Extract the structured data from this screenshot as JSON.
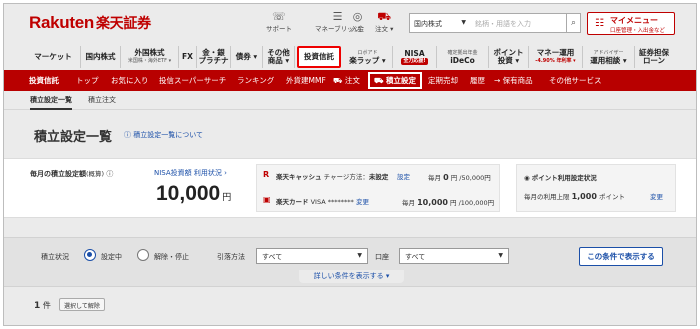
{
  "header": {
    "logo": "Rakuten",
    "logo_sub": "楽天証券",
    "icons": [
      {
        "name": "support",
        "label": "サポート",
        "glyph": "☏"
      },
      {
        "name": "money-bridge",
        "label": "マネーブリッジ",
        "glyph": "☰"
      },
      {
        "name": "deposit",
        "label": "入金",
        "glyph": "◎"
      },
      {
        "name": "order",
        "label": "注文 ▾",
        "glyph": "⛟"
      }
    ],
    "market_select": "国内株式",
    "search_placeholder": "銘柄・用語を入力",
    "mymenu_title": "マイメニュー",
    "mymenu_sub": "口座管理・入出金など"
  },
  "mainnav": [
    {
      "label": "マーケット"
    },
    {
      "label": "国内株式"
    },
    {
      "label": "外国株式",
      "sub": "米国株・海外ETF ▾"
    },
    {
      "label": "FX"
    },
    {
      "label": "金・銀",
      "label2": "プラチナ"
    },
    {
      "label": "債券 ▾"
    },
    {
      "label": "その他",
      "label2": "商品 ▾"
    },
    {
      "label": "投資信託"
    },
    {
      "label": "ロボアド",
      "label2": "楽ラップ ▾",
      "pre": "ロボアド"
    },
    {
      "label": "NISA",
      "tag": "全力応援!"
    },
    {
      "label": "確定拠出年金",
      "label2": "iDeCo"
    },
    {
      "label": "ポイント",
      "label2": "投資 ▾"
    },
    {
      "label": "マネー運用",
      "sub": "-4.90% 年利率 ▾"
    },
    {
      "label": "アドバイザー",
      "label2": "運用相談 ▾"
    },
    {
      "label": "証券担保",
      "label2": "ローン"
    }
  ],
  "subnav": [
    {
      "label": "投資信託"
    },
    {
      "label": "トップ"
    },
    {
      "label": "お気に入り"
    },
    {
      "label": "投信スーパーサーチ"
    },
    {
      "label": "ランキング"
    },
    {
      "label": "外貨建MMF"
    },
    {
      "label": "注文"
    },
    {
      "label": "積立設定"
    },
    {
      "label": "定期売却"
    },
    {
      "label": "履歴"
    },
    {
      "label": "→ 保有商品"
    },
    {
      "label": "その他サービス"
    }
  ],
  "tabs": {
    "tab1": "積立設定一覧",
    "tab2": "積立注文"
  },
  "page": {
    "title": "積立設定一覧",
    "about_link": "積立設定一覧について"
  },
  "summary": {
    "monthly_label": "毎月の積立設定額",
    "monthly_label_suffix": "(概算)",
    "nisa_link": "NISA投資額 利用状況",
    "amount": "10,000",
    "amount_unit": "円",
    "cash": {
      "name": "楽天キャッシュ",
      "method_label": "チャージ方法：",
      "method_value": "未設定",
      "setting_link": "設定",
      "monthly_prefix": "毎月",
      "monthly_value": "0",
      "monthly_limit": "円 /50,000円"
    },
    "card": {
      "name": "楽天カード",
      "number": "VISA ********",
      "change_link": "変更",
      "monthly_prefix": "毎月",
      "monthly_value": "10,000",
      "monthly_limit": "円 /100,000円"
    },
    "point": {
      "title": "ポイント利用設定状況",
      "limit_label": "毎月の利用上限",
      "limit_value": "1,000",
      "limit_unit": "ポイント",
      "change_link": "変更"
    }
  },
  "filter": {
    "status_label": "積立状況",
    "opt_active": "設定中",
    "opt_cancel": "解除・停止",
    "method_label": "引落方法",
    "method_value": "すべて",
    "account_label": "口座",
    "account_value": "すべて",
    "show_button": "この条件で表示する",
    "detail_link": "詳しい条件を表示する ▾"
  },
  "results": {
    "count": "1",
    "count_unit": "件",
    "select_button": "選択して解除"
  }
}
